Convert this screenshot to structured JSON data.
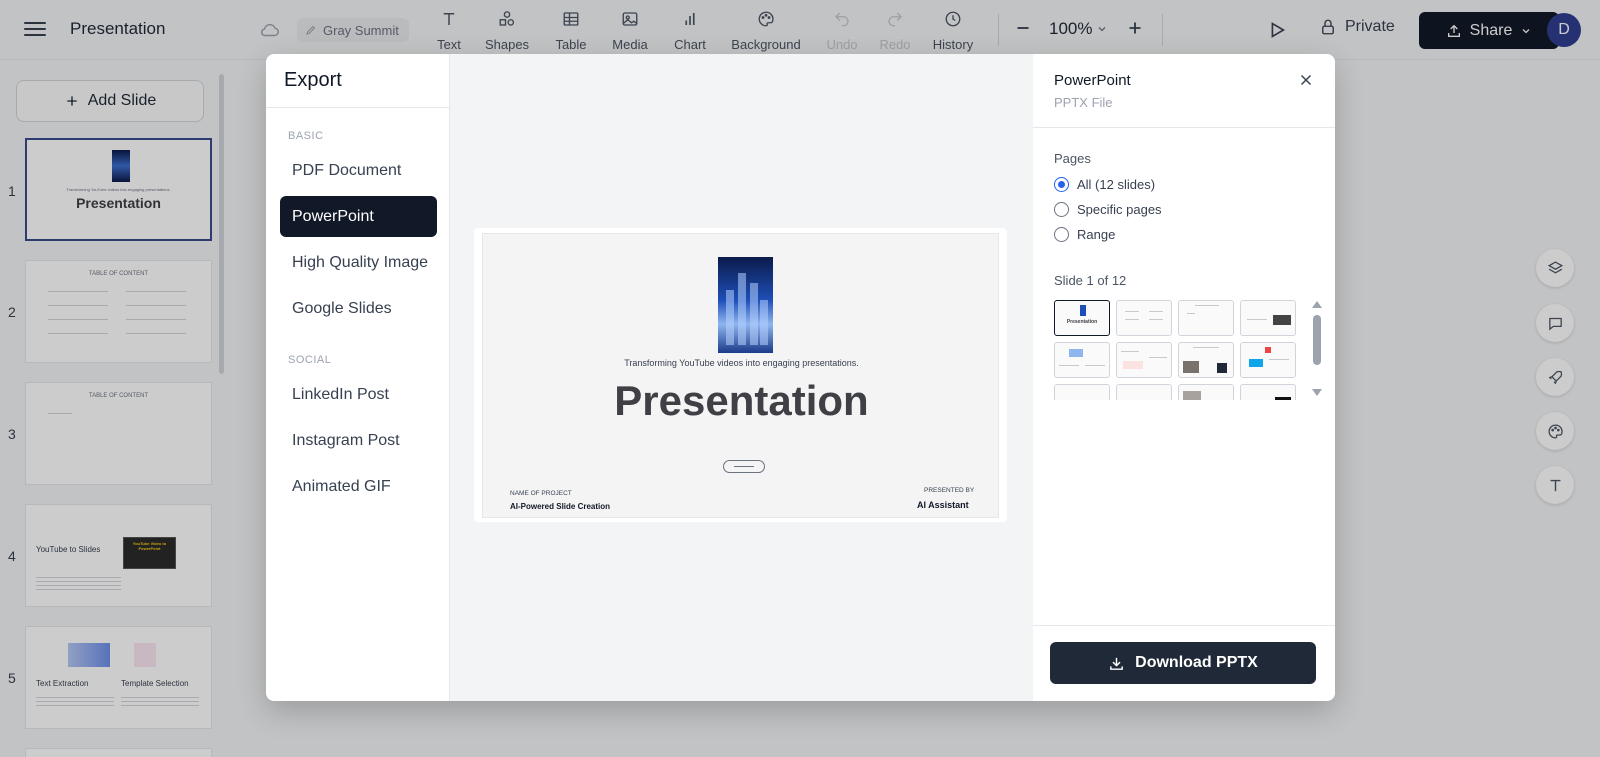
{
  "app": {
    "title": "Presentation",
    "doc_name": "Gray Summit",
    "zoom": "100%",
    "private_label": "Private",
    "share_label": "Share",
    "avatar_initial": "D"
  },
  "toolbar": {
    "items": [
      {
        "label": "Text",
        "icon": "text-icon"
      },
      {
        "label": "Shapes",
        "icon": "shapes-icon"
      },
      {
        "label": "Table",
        "icon": "table-icon"
      },
      {
        "label": "Media",
        "icon": "image-icon"
      },
      {
        "label": "Chart",
        "icon": "chart-icon"
      },
      {
        "label": "Background",
        "icon": "palette-icon"
      },
      {
        "label": "Undo",
        "icon": "undo-icon",
        "disabled": true
      },
      {
        "label": "Redo",
        "icon": "redo-icon",
        "disabled": true
      },
      {
        "label": "History",
        "icon": "clock-icon"
      }
    ]
  },
  "sidebar": {
    "add_slide_label": "Add Slide",
    "slides": [
      {
        "num": "1",
        "title": "Presentation",
        "subtitle": "Transforming YouTube videos into engaging presentations."
      },
      {
        "num": "2",
        "title": "TABLE OF CONTENT"
      },
      {
        "num": "3",
        "title": "TABLE OF CONTENT"
      },
      {
        "num": "4",
        "title": "YouTube to Slides",
        "badge": "YouTube Video to PowerPoint"
      },
      {
        "num": "5",
        "title_a": "Text Extraction",
        "title_b": "Template Selection"
      }
    ]
  },
  "modal": {
    "title": "Export",
    "sections": [
      {
        "label": "BASIC",
        "items": [
          "PDF Document",
          "PowerPoint",
          "High Quality Image",
          "Google Slides"
        ]
      },
      {
        "label": "SOCIAL",
        "items": [
          "LinkedIn Post",
          "Instagram Post",
          "Animated GIF"
        ]
      }
    ],
    "selected": "PowerPoint",
    "preview": {
      "subtitle": "Transforming YouTube videos into engaging presentations.",
      "title": "Presentation",
      "project_label": "NAME OF PROJECT",
      "project_value": "AI-Powered Slide Creation",
      "presenter_label": "PRESENTED BY",
      "presenter_value": "AI Assistant"
    },
    "panel": {
      "format_title": "PowerPoint",
      "format_sub": "PPTX File",
      "pages_label": "Pages",
      "options": [
        "All (12 slides)",
        "Specific pages",
        "Range"
      ],
      "selected_option": "All (12 slides)",
      "slide_counter": "Slide 1 of 12",
      "download_label": "Download PPTX"
    }
  },
  "colors": {
    "primary_dark": "#111827",
    "accent_blue": "#2563eb",
    "avatar": "#2f3e8f"
  }
}
